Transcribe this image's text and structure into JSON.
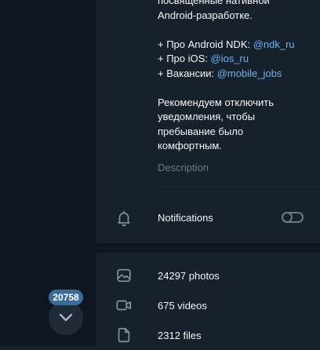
{
  "scroll": {
    "unread_count": "20758"
  },
  "channel_info": {
    "description_lines": [
      "посвященные нативной",
      "Android-разработке."
    ],
    "links": [
      {
        "prefix": "+ Про Android NDK: ",
        "handle": "@ndk_ru"
      },
      {
        "prefix": "+ Про iOS: ",
        "handle": "@ios_ru"
      },
      {
        "prefix": "+ Вакансии: ",
        "handle": "@mobile_jobs"
      }
    ],
    "recommendation_lines": [
      "Рекомендуем отключить",
      "уведомления, чтобы",
      "пребывание было",
      "комфортным."
    ],
    "description_label": "Description"
  },
  "notifications": {
    "label": "Notifications",
    "enabled": false
  },
  "media": {
    "photos": "24297 photos",
    "videos": "675 videos",
    "files": "2312 files"
  },
  "colors": {
    "link": "#6ab3f3",
    "badge": "#3e6a98",
    "panel_bg": "#17212b",
    "chat_bg": "#0e1621",
    "muted": "#6d7883"
  }
}
